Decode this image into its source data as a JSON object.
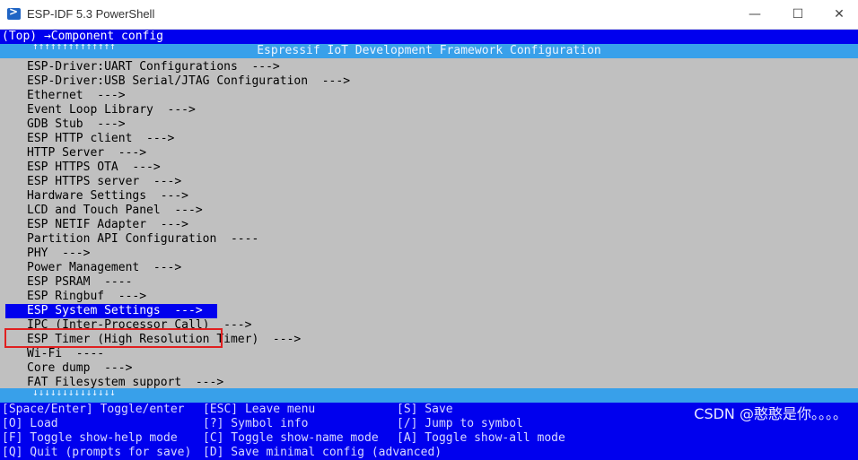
{
  "window": {
    "title": "ESP-IDF 5.3 PowerShell",
    "minimize": "—",
    "maximize": "☐",
    "close": "✕"
  },
  "breadcrumb": "(Top) →Component config",
  "frame_title": "Espressif IoT Development Framework Configuration",
  "scroll_up": "↑↑↑↑↑↑↑↑↑↑↑↑↑↑",
  "scroll_down": "↓↓↓↓↓↓↓↓↓↓↓↓↓↓",
  "menu_items": [
    "ESP-Driver:UART Configurations  --->",
    "ESP-Driver:USB Serial/JTAG Configuration  --->",
    "Ethernet  --->",
    "Event Loop Library  --->",
    "GDB Stub  --->",
    "ESP HTTP client  --->",
    "HTTP Server  --->",
    "ESP HTTPS OTA  --->",
    "ESP HTTPS server  --->",
    "Hardware Settings  --->",
    "LCD and Touch Panel  --->",
    "ESP NETIF Adapter  --->",
    "Partition API Configuration  ----",
    "PHY  --->",
    "Power Management  --->",
    "ESP PSRAM  ----",
    "ESP Ringbuf  --->",
    "ESP System Settings  --->",
    "IPC (Inter-Processor Call)  --->",
    "ESP Timer (High Resolution Timer)  --->",
    "Wi-Fi  ----",
    "Core dump  --->",
    "FAT Filesystem support  --->"
  ],
  "selected_index": 17,
  "help": {
    "col1": [
      "[Space/Enter] Toggle/enter",
      "[O] Load",
      "[F] Toggle show-help mode",
      "[Q] Quit (prompts for save)"
    ],
    "col2": [
      "[ESC] Leave menu",
      "[?] Symbol info",
      "[C] Toggle show-name mode",
      "[D] Save minimal config (advanced)"
    ],
    "col3": [
      "[S] Save",
      "[/] Jump to symbol",
      "[A] Toggle show-all mode",
      ""
    ]
  },
  "watermark": "CSDN @憨憨是你。。。。",
  "colors": {
    "terminal_bg": "#0000ee",
    "frame": "#38a0ea",
    "menu_bg": "#c0c0c0",
    "highlight_box": "#e02020"
  }
}
